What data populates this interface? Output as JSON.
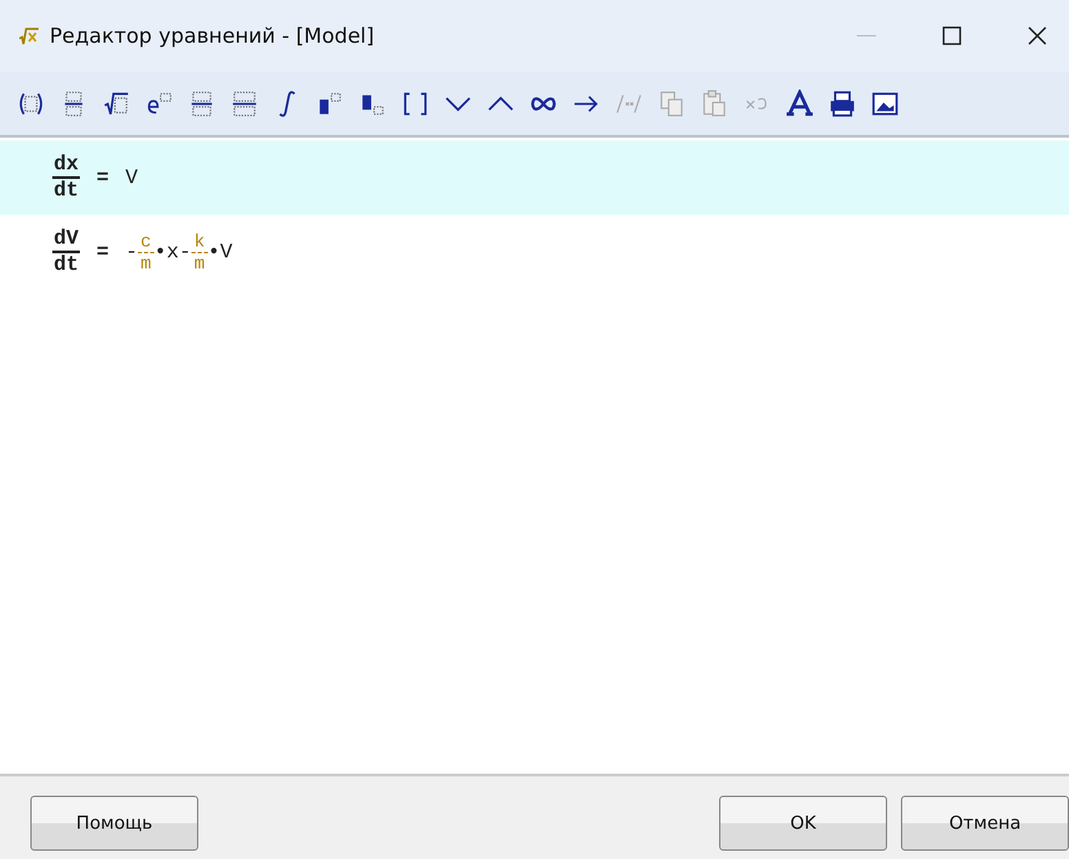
{
  "window": {
    "title": "Редактор уравнений - [Model]",
    "controls": [
      {
        "kind": "minimize",
        "disabled": true
      },
      {
        "kind": "maximize",
        "disabled": false
      },
      {
        "kind": "close",
        "disabled": false
      }
    ]
  },
  "toolbar": [
    {
      "kind": "parens",
      "disabled": false
    },
    {
      "kind": "fraction",
      "disabled": false
    },
    {
      "kind": "sqrt",
      "disabled": false
    },
    {
      "kind": "exp",
      "disabled": false
    },
    {
      "kind": "deriv",
      "disabled": false
    },
    {
      "kind": "deriv2",
      "disabled": false
    },
    {
      "kind": "integral",
      "disabled": false
    },
    {
      "kind": "superscript",
      "disabled": false
    },
    {
      "kind": "subscript",
      "disabled": false
    },
    {
      "kind": "brackets",
      "disabled": false
    },
    {
      "kind": "chevron-down",
      "disabled": false
    },
    {
      "kind": "chevron-up",
      "disabled": false
    },
    {
      "kind": "infinity",
      "disabled": false
    },
    {
      "kind": "arrow",
      "disabled": false
    },
    {
      "kind": "comment",
      "disabled": true
    },
    {
      "kind": "copy",
      "disabled": true
    },
    {
      "kind": "paste",
      "disabled": true
    },
    {
      "kind": "undo",
      "disabled": true
    },
    {
      "kind": "font",
      "disabled": false
    },
    {
      "kind": "print",
      "disabled": false
    },
    {
      "kind": "image",
      "disabled": false
    }
  ],
  "equations": [
    {
      "selected": true,
      "lhs": {
        "num": "dx",
        "den": "dt"
      },
      "op": "=",
      "rhs": [
        {
          "kind": "text",
          "text": "V"
        }
      ]
    },
    {
      "selected": false,
      "lhs": {
        "num": "dV",
        "den": "dt"
      },
      "op": "=",
      "rhs": [
        {
          "kind": "text",
          "text": "-"
        },
        {
          "kind": "fraction",
          "num": "c",
          "den": "m",
          "color": "#b8860b"
        },
        {
          "kind": "text",
          "text": "•x-"
        },
        {
          "kind": "fraction",
          "num": "k",
          "den": "m",
          "color": "#b8860b"
        },
        {
          "kind": "text",
          "text": "•V"
        }
      ]
    }
  ],
  "buttons": [
    {
      "label": "Помощь",
      "kind": "help"
    },
    {
      "label": "OK",
      "kind": "ok"
    },
    {
      "label": "Отмена",
      "kind": "cancel"
    }
  ]
}
